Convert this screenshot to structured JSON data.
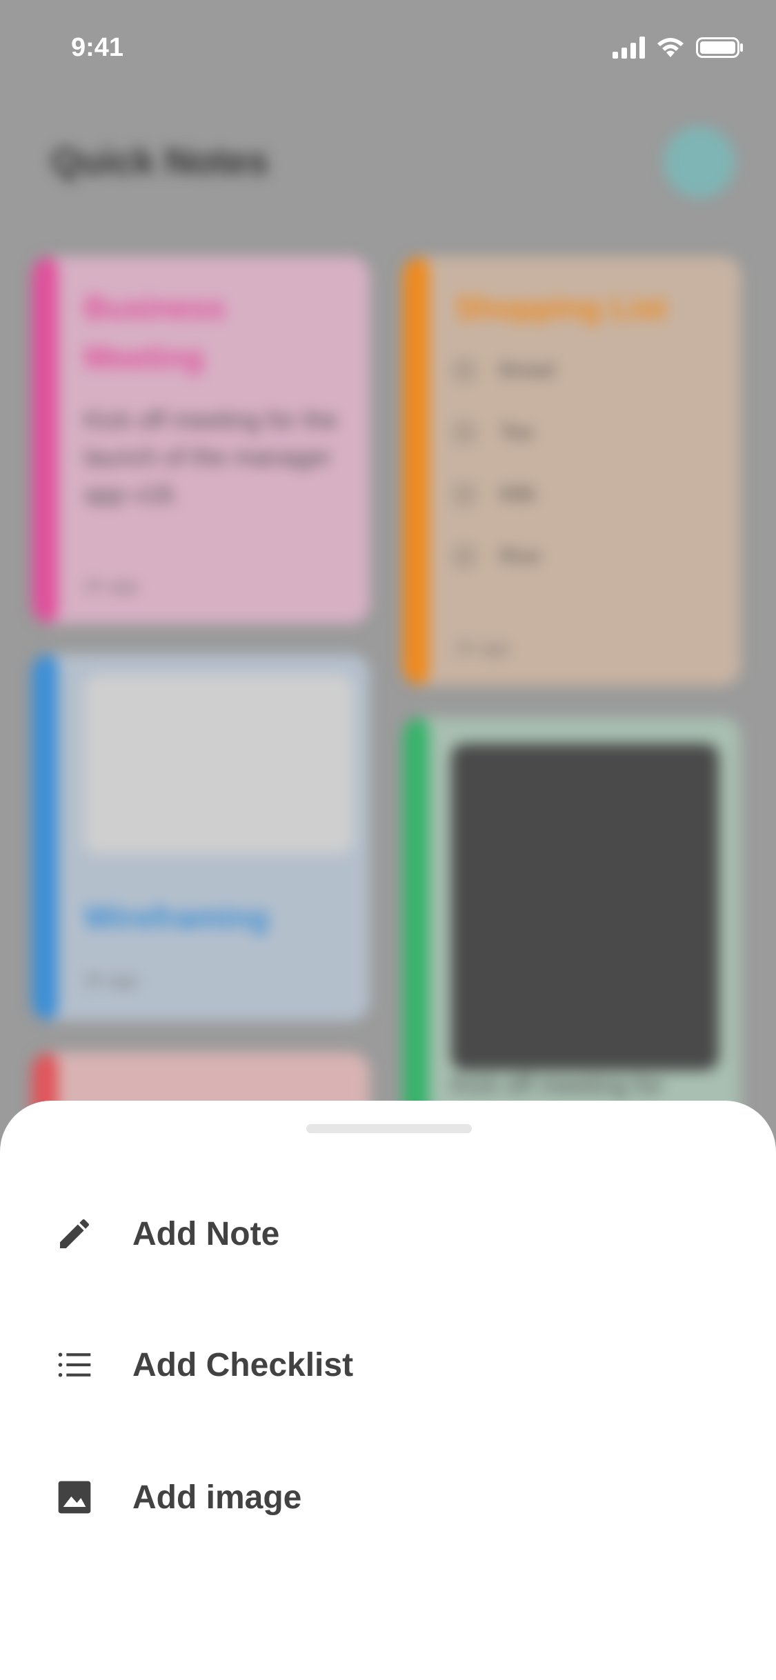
{
  "status_bar": {
    "time": "9:41",
    "icons": [
      "signal-icon",
      "wifi-icon",
      "battery-icon"
    ]
  },
  "background_app": {
    "title": "Quick Notes",
    "add_button_icon": "plus-icon",
    "notes": [
      {
        "title": "Business Meeting",
        "body": "Kick off meeting for the launch of the manager app v18.",
        "time": "2h ago",
        "color": "#e0509c"
      },
      {
        "title": "Shopping List",
        "items": [
          "Bread",
          "Tea",
          "Milk",
          "Rice"
        ],
        "time": "2h ago",
        "color": "#ef8a1e"
      },
      {
        "title": "Wireframing",
        "time": "2h ago",
        "color": "#3c8fd6"
      },
      {
        "body": "Kick off meeting for",
        "color": "#36b36a"
      },
      {
        "color": "#e0545a"
      }
    ]
  },
  "sheet": {
    "actions": [
      {
        "label": "Add Note",
        "icon": "pencil-icon"
      },
      {
        "label": "Add Checklist",
        "icon": "checklist-icon"
      },
      {
        "label": "Add image",
        "icon": "image-icon"
      }
    ]
  },
  "colors": {
    "overlay": "#9b9b9b",
    "sheet": "#ffffff",
    "text": "#424242"
  }
}
